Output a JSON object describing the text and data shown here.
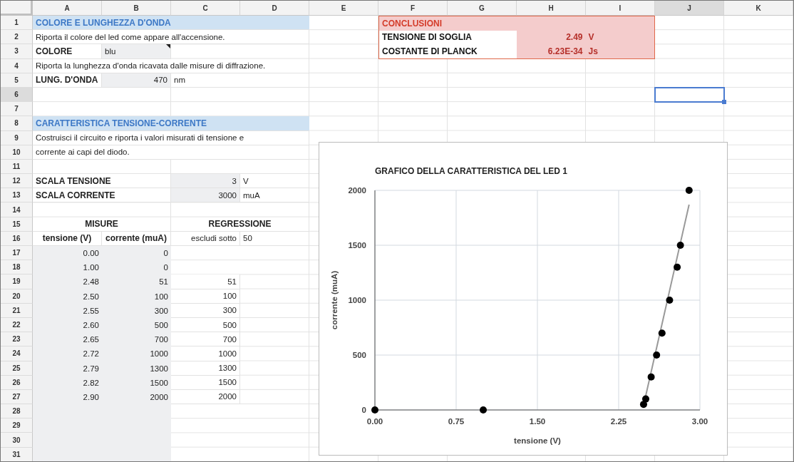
{
  "columns": [
    {
      "label": "A",
      "selected": false
    },
    {
      "label": "B",
      "selected": false
    },
    {
      "label": "C",
      "selected": false
    },
    {
      "label": "D",
      "selected": false
    },
    {
      "label": "E",
      "selected": false
    },
    {
      "label": "F",
      "selected": false
    },
    {
      "label": "G",
      "selected": false
    },
    {
      "label": "H",
      "selected": false
    },
    {
      "label": "I",
      "selected": false
    },
    {
      "label": "J",
      "selected": true
    },
    {
      "label": "K",
      "selected": false
    }
  ],
  "rows": [
    {
      "number": "1",
      "selected": false,
      "cells": {
        "A": {
          "kind": "section",
          "text": "COLORE E LUNGHEZZA D'ONDA"
        }
      }
    },
    {
      "number": "2",
      "selected": false,
      "cells": {
        "A": {
          "kind": "text",
          "text": "Riporta il colore del led come appare all'accensione."
        }
      }
    },
    {
      "number": "3",
      "selected": false,
      "cells": {
        "A": {
          "kind": "label",
          "text": "COLORE"
        },
        "B": {
          "kind": "input_text",
          "text": "blu",
          "has_note": true
        }
      }
    },
    {
      "number": "4",
      "selected": false,
      "cells": {
        "A": {
          "kind": "text",
          "text": "Riporta la lunghezza d'onda ricavata dalle misure di diffrazione."
        }
      }
    },
    {
      "number": "5",
      "selected": false,
      "cells": {
        "A": {
          "kind": "label",
          "text": "LUNG. D'ONDA"
        },
        "B": {
          "kind": "input_number",
          "text": "470"
        },
        "C": {
          "kind": "text",
          "text": "nm"
        }
      }
    },
    {
      "number": "6",
      "selected": true
    },
    {
      "number": "7",
      "selected": false
    },
    {
      "number": "8",
      "selected": false,
      "cells": {
        "A": {
          "kind": "section",
          "text": "CARATTERISTICA TENSIONE-CORRENTE"
        }
      }
    },
    {
      "number": "9",
      "selected": false,
      "cells": {
        "A": {
          "kind": "text",
          "text": "Costruisci il circuito e riporta i valori misurati di tensione e"
        }
      }
    },
    {
      "number": "10",
      "selected": false,
      "cells": {
        "A": {
          "kind": "text",
          "text": "corrente ai capi del diodo."
        }
      }
    },
    {
      "number": "11",
      "selected": false
    },
    {
      "number": "12",
      "selected": false,
      "cells": {
        "A": {
          "kind": "label",
          "text": "SCALA TENSIONE"
        },
        "C": {
          "kind": "input_number",
          "text": "3"
        },
        "D": {
          "kind": "text",
          "text": "V"
        }
      }
    },
    {
      "number": "13",
      "selected": false,
      "cells": {
        "A": {
          "kind": "label",
          "text": "SCALA CORRENTE"
        },
        "C": {
          "kind": "input_number",
          "text": "3000"
        },
        "D": {
          "kind": "text",
          "text": "muA"
        }
      }
    },
    {
      "number": "14",
      "selected": false
    },
    {
      "number": "15",
      "selected": false,
      "cells": {
        "A": {
          "kind": "group_header",
          "text": "MISURE"
        },
        "C": {
          "kind": "group_header",
          "text": "REGRESSIONE"
        }
      }
    },
    {
      "number": "16",
      "selected": false,
      "cells": {
        "A": {
          "kind": "header",
          "text": "tensione (V)"
        },
        "B": {
          "kind": "header",
          "text": "corrente (muA)"
        },
        "C": {
          "kind": "number",
          "text": "escludi sotto"
        },
        "D": {
          "kind": "text",
          "text": "50"
        }
      }
    },
    {
      "number": "17",
      "selected": false,
      "cells": {
        "A": {
          "kind": "data",
          "text": "0.00"
        },
        "B": {
          "kind": "data",
          "text": "0"
        }
      }
    },
    {
      "number": "18",
      "selected": false,
      "cells": {
        "A": {
          "kind": "data",
          "text": "1.00"
        },
        "B": {
          "kind": "data",
          "text": "0"
        }
      }
    },
    {
      "number": "19",
      "selected": false,
      "cells": {
        "A": {
          "kind": "data",
          "text": "2.48"
        },
        "B": {
          "kind": "data",
          "text": "51"
        },
        "C": {
          "kind": "number",
          "text": "51"
        }
      }
    },
    {
      "number": "20",
      "selected": false,
      "cells": {
        "A": {
          "kind": "data",
          "text": "2.50"
        },
        "B": {
          "kind": "data",
          "text": "100"
        },
        "C": {
          "kind": "number",
          "text": "100"
        }
      }
    },
    {
      "number": "21",
      "selected": false,
      "cells": {
        "A": {
          "kind": "data",
          "text": "2.55"
        },
        "B": {
          "kind": "data",
          "text": "300"
        },
        "C": {
          "kind": "number",
          "text": "300"
        }
      }
    },
    {
      "number": "22",
      "selected": false,
      "cells": {
        "A": {
          "kind": "data",
          "text": "2.60"
        },
        "B": {
          "kind": "data",
          "text": "500"
        },
        "C": {
          "kind": "number",
          "text": "500"
        }
      }
    },
    {
      "number": "23",
      "selected": false,
      "cells": {
        "A": {
          "kind": "data",
          "text": "2.65"
        },
        "B": {
          "kind": "data",
          "text": "700"
        },
        "C": {
          "kind": "number",
          "text": "700"
        }
      }
    },
    {
      "number": "24",
      "selected": false,
      "cells": {
        "A": {
          "kind": "data",
          "text": "2.72"
        },
        "B": {
          "kind": "data",
          "text": "1000"
        },
        "C": {
          "kind": "number",
          "text": "1000"
        }
      }
    },
    {
      "number": "25",
      "selected": false,
      "cells": {
        "A": {
          "kind": "data",
          "text": "2.79"
        },
        "B": {
          "kind": "data",
          "text": "1300"
        },
        "C": {
          "kind": "number",
          "text": "1300"
        }
      }
    },
    {
      "number": "26",
      "selected": false,
      "cells": {
        "A": {
          "kind": "data",
          "text": "2.82"
        },
        "B": {
          "kind": "data",
          "text": "1500"
        },
        "C": {
          "kind": "number",
          "text": "1500"
        }
      }
    },
    {
      "number": "27",
      "selected": false,
      "cells": {
        "A": {
          "kind": "data",
          "text": "2.90"
        },
        "B": {
          "kind": "data",
          "text": "2000"
        },
        "C": {
          "kind": "number",
          "text": "2000"
        }
      }
    },
    {
      "number": "28",
      "selected": false
    },
    {
      "number": "29",
      "selected": false
    },
    {
      "number": "30",
      "selected": false
    },
    {
      "number": "31",
      "selected": false
    }
  ],
  "conclusions": {
    "title": "CONCLUSIONI",
    "rows": [
      {
        "label": "TENSIONE DI SOGLIA",
        "value": "2.49",
        "unit": "V"
      },
      {
        "label": "COSTANTE DI PLANCK",
        "value": "6.23E-34",
        "unit": "Js"
      }
    ]
  },
  "chart": {
    "chart_data": {
      "type": "scatter",
      "title": "GRAFICO DELLA CARATTERISTICA DEL LED 1",
      "xlabel": "tensione (V)",
      "ylabel": "corrente (muA)",
      "grid": true,
      "x": [
        0,
        1,
        2.48,
        2.5,
        2.55,
        2.6,
        2.65,
        2.72,
        2.79,
        2.82,
        2.9
      ],
      "series": [
        {
          "color": "#000000",
          "values": [
            0,
            0,
            51,
            100,
            300,
            500,
            700,
            1000,
            1300,
            1500,
            2000
          ]
        },
        {
          "type": "line",
          "color": "#999999",
          "values": [
            null,
            null,
            43,
            130,
            348,
            565,
            783,
            1087,
            1391,
            1522,
            1870
          ]
        }
      ],
      "xlim": [
        0,
        3
      ],
      "ylim": [
        0,
        2000
      ],
      "xticks": [
        {
          "value": 0,
          "label": "0.00"
        },
        {
          "value": 0.75,
          "label": "0.75"
        },
        {
          "value": 1.5,
          "label": "1.50"
        },
        {
          "value": 2.25,
          "label": "2.25"
        },
        {
          "value": 3,
          "label": "3.00"
        }
      ],
      "yticks": [
        {
          "value": 0,
          "label": "0"
        },
        {
          "value": 500,
          "label": "500"
        },
        {
          "value": 1000,
          "label": "1000"
        },
        {
          "value": 1500,
          "label": "1500"
        },
        {
          "value": 2000,
          "label": "2000"
        }
      ]
    }
  }
}
